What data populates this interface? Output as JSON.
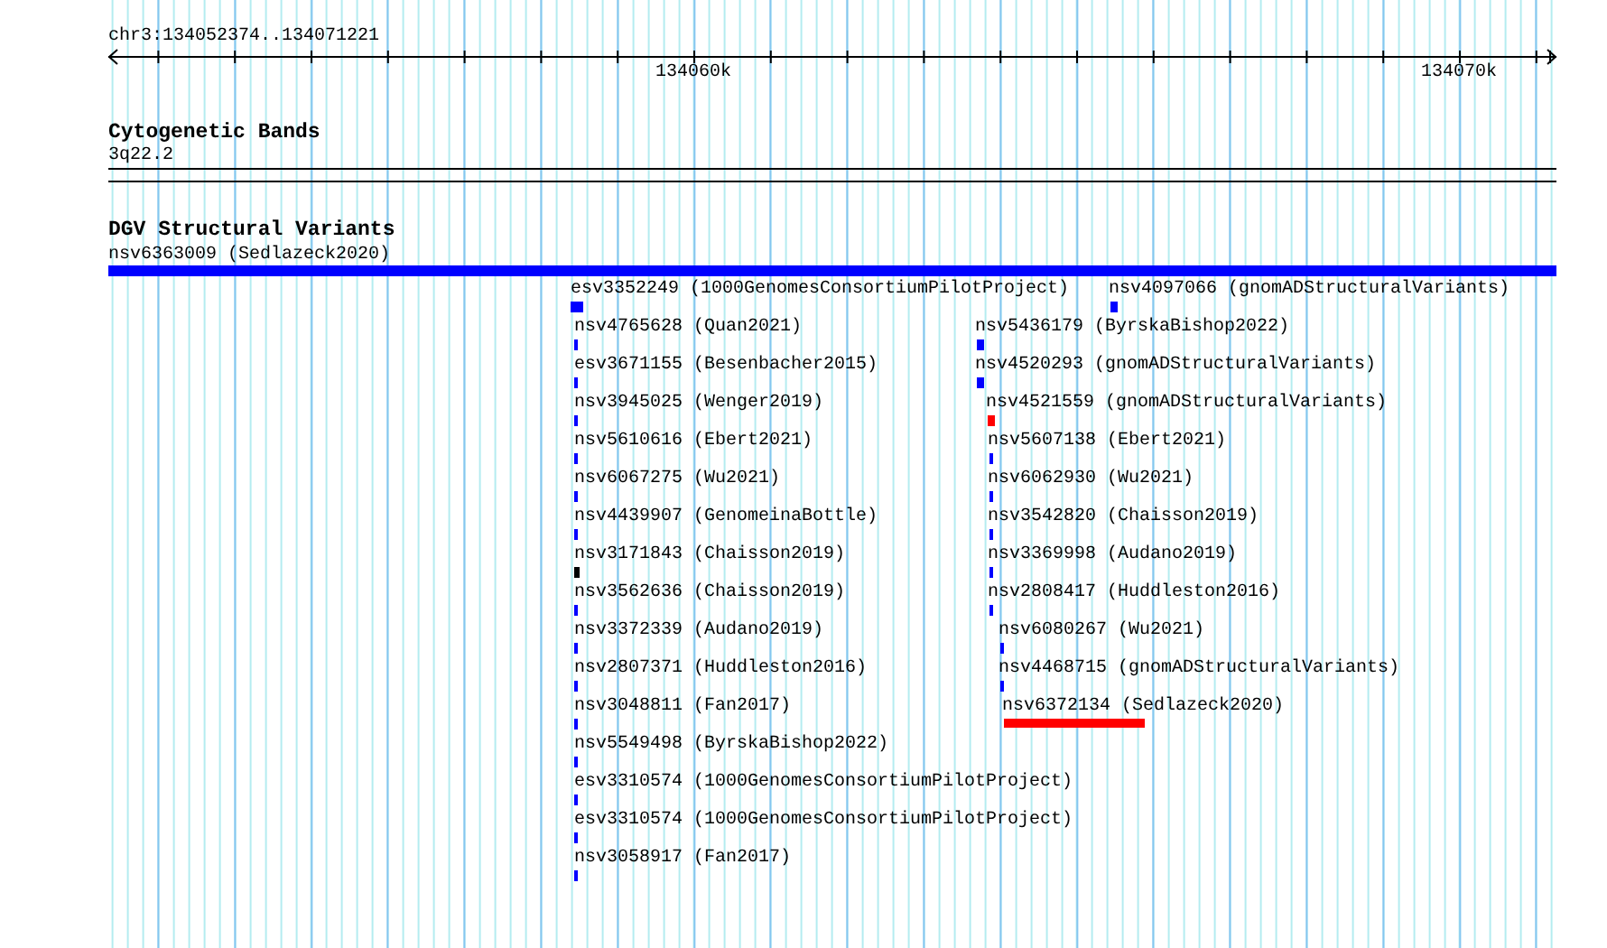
{
  "ruler": {
    "title": "chr3:134052374..134071221",
    "tick_labels": [
      "134060k",
      "134070k"
    ]
  },
  "cytoband_track": {
    "title": "Cytogenetic Bands",
    "band": "3q22.2"
  },
  "dgv_track": {
    "title": "DGV Structural Variants",
    "features": [
      {
        "label": "nsv6363009 (Sedlazeck2020)",
        "color": "#0000ff"
      },
      {
        "label": "esv3352249 (1000GenomesConsortiumPilotProject)",
        "color": "#0000ff"
      },
      {
        "label": "nsv4097066 (gnomADStructuralVariants)",
        "color": "#0000ff"
      },
      {
        "label": "nsv4765628 (Quan2021)",
        "color": "#0000ff"
      },
      {
        "label": "nsv5436179 (ByrskaBishop2022)",
        "color": "#0000ff"
      },
      {
        "label": "esv3671155 (Besenbacher2015)",
        "color": "#0000ff"
      },
      {
        "label": "nsv4520293 (gnomADStructuralVariants)",
        "color": "#0000ff"
      },
      {
        "label": "nsv3945025 (Wenger2019)",
        "color": "#0000ff"
      },
      {
        "label": "nsv4521559 (gnomADStructuralVariants)",
        "color": "#ff0000"
      },
      {
        "label": "nsv5610616 (Ebert2021)",
        "color": "#0000ff"
      },
      {
        "label": "nsv5607138 (Ebert2021)",
        "color": "#0000ff"
      },
      {
        "label": "nsv6067275 (Wu2021)",
        "color": "#0000ff"
      },
      {
        "label": "nsv6062930 (Wu2021)",
        "color": "#0000ff"
      },
      {
        "label": "nsv4439907 (GenomeinaBottle)",
        "color": "#0000ff"
      },
      {
        "label": "nsv3542820 (Chaisson2019)",
        "color": "#0000ff"
      },
      {
        "label": "nsv3171843 (Chaisson2019)",
        "color": "#000000"
      },
      {
        "label": "nsv3369998 (Audano2019)",
        "color": "#0000ff"
      },
      {
        "label": "nsv3562636 (Chaisson2019)",
        "color": "#0000ff"
      },
      {
        "label": "nsv2808417 (Huddleston2016)",
        "color": "#0000ff"
      },
      {
        "label": "nsv3372339 (Audano2019)",
        "color": "#0000ff"
      },
      {
        "label": "nsv6080267 (Wu2021)",
        "color": "#0000ff"
      },
      {
        "label": "nsv2807371 (Huddleston2016)",
        "color": "#0000ff"
      },
      {
        "label": "nsv4468715 (gnomADStructuralVariants)",
        "color": "#0000ff"
      },
      {
        "label": "nsv3048811 (Fan2017)",
        "color": "#0000ff"
      },
      {
        "label": "nsv6372134 (Sedlazeck2020)",
        "color": "#ff0000"
      },
      {
        "label": "nsv5549498 (ByrskaBishop2022)",
        "color": "#0000ff"
      },
      {
        "label": "esv3310574 (1000GenomesConsortiumPilotProject)",
        "color": "#0000ff"
      },
      {
        "label": "esv3310574 (1000GenomesConsortiumPilotProject)",
        "color": "#0000ff"
      },
      {
        "label": "nsv3058917 (Fan2017)",
        "color": "#0000ff"
      }
    ]
  }
}
